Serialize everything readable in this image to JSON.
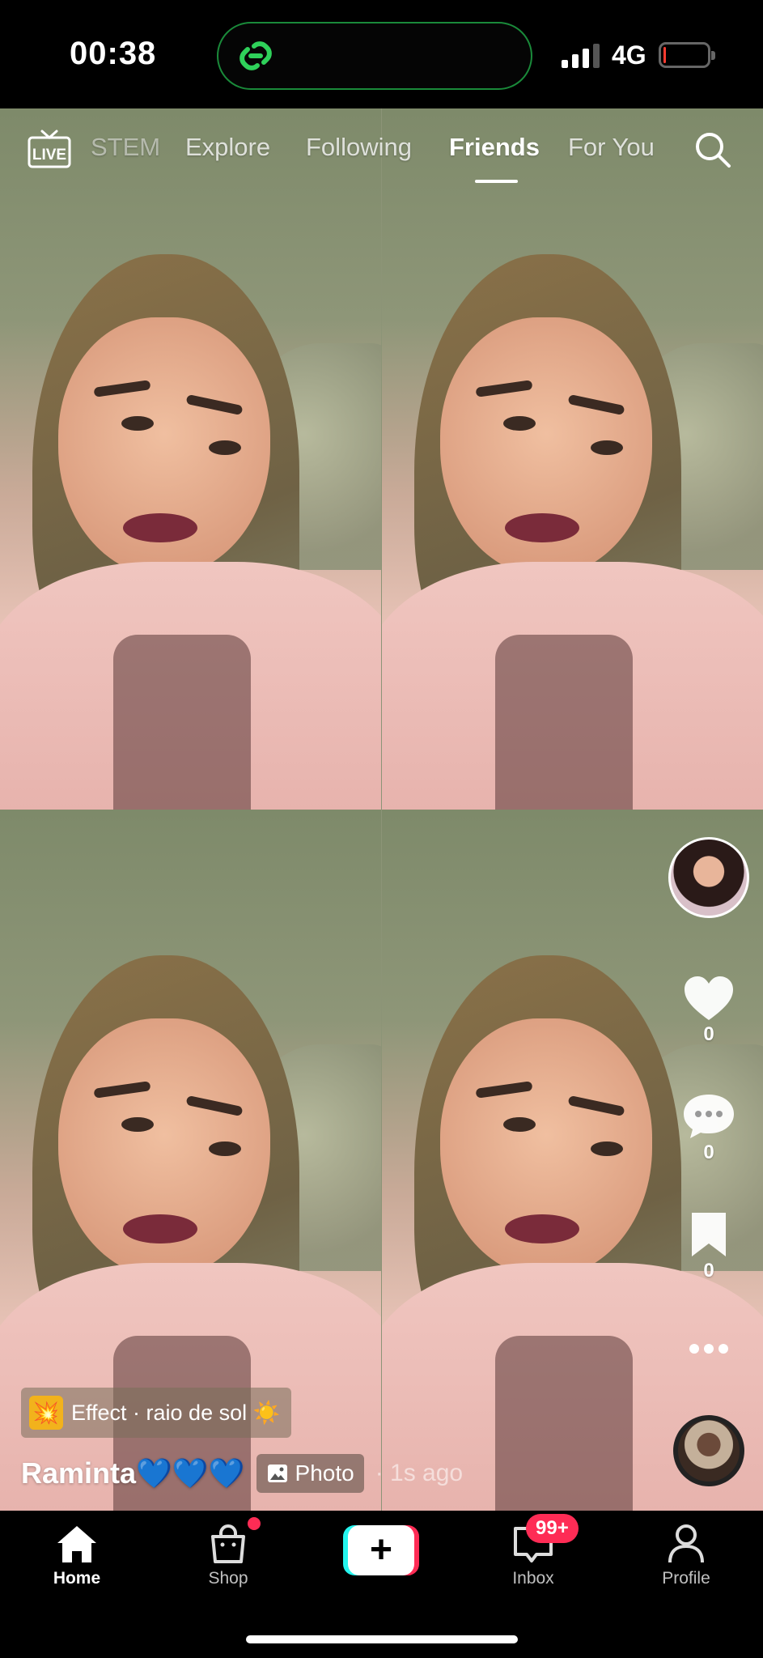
{
  "status_bar": {
    "time": "00:38",
    "network": "4G",
    "battery_level_percent": 5
  },
  "top_nav": {
    "tabs": [
      {
        "label": "STEM",
        "active": false
      },
      {
        "label": "Explore",
        "active": false
      },
      {
        "label": "Following",
        "active": false
      },
      {
        "label": "Friends",
        "active": true
      },
      {
        "label": "For You",
        "active": false
      }
    ]
  },
  "actions": {
    "likes": "0",
    "comments": "0",
    "saves": "0"
  },
  "post": {
    "effect_label": "Effect · raio de sol ☀️",
    "effect_icon": "💥",
    "username": "Raminta💙💙💙",
    "photo_label": "Photo",
    "timestamp": "· 1s ago"
  },
  "bottom_nav": {
    "items": [
      {
        "label": "Home",
        "icon": "home-icon",
        "active": true
      },
      {
        "label": "Shop",
        "icon": "shop-bag-icon",
        "active": false
      },
      {
        "label": "",
        "icon": "create-plus-icon",
        "active": false
      },
      {
        "label": "Inbox",
        "icon": "inbox-icon",
        "active": false
      },
      {
        "label": "Profile",
        "icon": "profile-icon",
        "active": false
      }
    ],
    "inbox_badge": "99+"
  },
  "colors": {
    "accent": "#fe2c55",
    "cyan": "#25f4ee",
    "island_border": "#1a8a3a"
  }
}
